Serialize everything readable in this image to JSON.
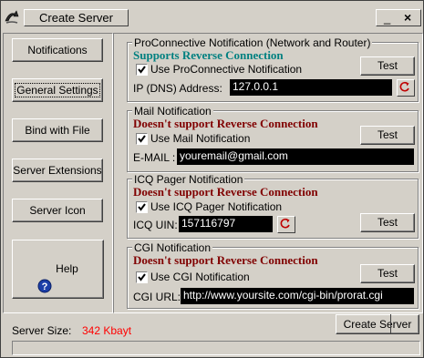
{
  "window": {
    "title": "Create Server",
    "minimize_glyph": "_",
    "close_glyph": "×",
    "icon": "app-icon"
  },
  "sidebar": {
    "notifications": "Notifications",
    "general_settings": "General Settings",
    "bind_with_file": "Bind with File",
    "server_extensions": "Server Extensions",
    "server_icon": "Server Icon",
    "help": "Help",
    "help_icon": "help-icon"
  },
  "proconnective": {
    "title": "ProConnective Notification (Network and Router)",
    "status": "Supports Reverse Connection",
    "status_color": "#008080",
    "checkbox_label": "Use ProConnective Notification",
    "checked": true,
    "test": "Test",
    "field_label": "IP (DNS) Address:",
    "field_value": "127.0.0.1"
  },
  "mail": {
    "title": "Mail Notification",
    "status": "Doesn't support Reverse Connection",
    "status_color": "#800000",
    "checkbox_label": "Use Mail Notification",
    "checked": true,
    "test": "Test",
    "field_label": "E-MAIL :",
    "field_value": "youremail@gmail.com"
  },
  "icq": {
    "title": "ICQ Pager Notification",
    "status": "Doesn't support Reverse Connection",
    "status_color": "#800000",
    "checkbox_label": "Use ICQ Pager Notification",
    "checked": true,
    "test": "Test",
    "field_label": "ICQ UIN:",
    "field_value": "157116797"
  },
  "cgi": {
    "title": "CGI Notification",
    "status": "Doesn't support Reverse Connection",
    "status_color": "#800000",
    "checkbox_label": "Use CGI Notification",
    "checked": true,
    "test": "Test",
    "field_label": "CGI URL:",
    "field_value": "http://www.yoursite.com/cgi-bin/prorat.cgi"
  },
  "footer": {
    "server_size_label": "Server Size:",
    "server_size_value": "342 Kbayt",
    "server_size_color": "#ff0000",
    "create_server": "Create Server"
  }
}
